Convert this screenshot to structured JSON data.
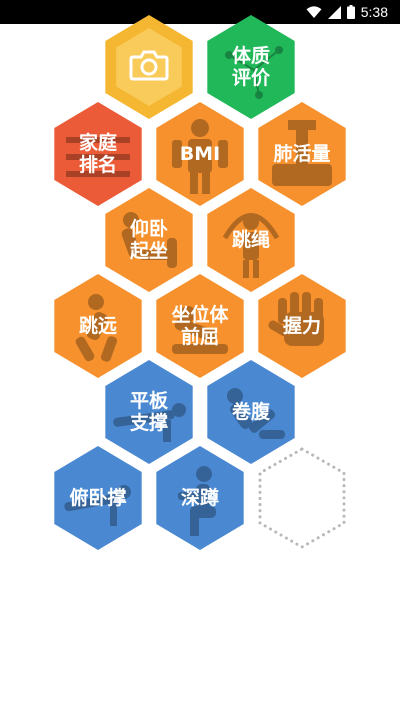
{
  "status_bar": {
    "time": "5:38",
    "icons": [
      "wifi-icon",
      "signal-icon",
      "battery-icon"
    ]
  },
  "colors": {
    "orange": "#f6912d",
    "yellow": "#f5b731",
    "green": "#21b85a",
    "red": "#ec5b37",
    "blue": "#4a89d2"
  },
  "tiles": {
    "camera": {
      "icon": "camera-icon"
    },
    "body_eval": {
      "label": "体质\n评价"
    },
    "family_rank": {
      "label": "家庭\n排名"
    },
    "bmi": {
      "label": "BMI"
    },
    "lung": {
      "label": "肺活量"
    },
    "situp": {
      "label": "仰卧\n起坐"
    },
    "rope": {
      "label": "跳绳"
    },
    "long_jump": {
      "label": "跳远"
    },
    "sit_reach": {
      "label": "坐位体\n前屈"
    },
    "grip": {
      "label": "握力"
    },
    "plank": {
      "label": "平板\n支撑"
    },
    "crunch": {
      "label": "卷腹"
    },
    "pushup": {
      "label": "俯卧撑"
    },
    "squat": {
      "label": "深蹲"
    }
  }
}
